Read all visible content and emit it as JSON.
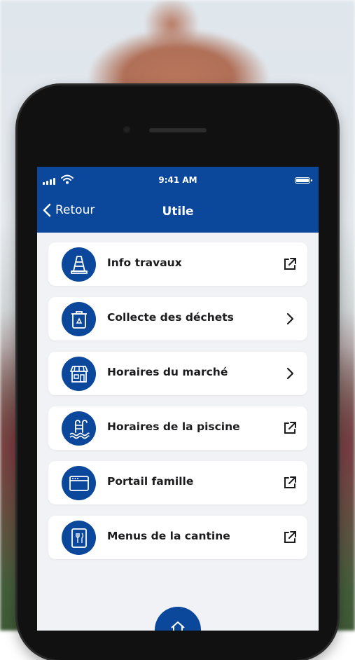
{
  "status_bar": {
    "time": "9:41 AM"
  },
  "header": {
    "back_label": "Retour",
    "title": "Utile"
  },
  "items": [
    {
      "label": "Info travaux",
      "icon": "traffic-cone-icon",
      "action": "external-link-icon"
    },
    {
      "label": "Collecte des déchets",
      "icon": "recycling-bin-icon",
      "action": "chevron-right-icon"
    },
    {
      "label": "Horaires du marché",
      "icon": "market-stall-icon",
      "action": "chevron-right-icon"
    },
    {
      "label": "Horaires de la piscine",
      "icon": "swimming-pool-icon",
      "action": "external-link-icon"
    },
    {
      "label": "Portail famille",
      "icon": "browser-window-icon",
      "action": "external-link-icon"
    },
    {
      "label": "Menus de la cantine",
      "icon": "menu-card-icon",
      "action": "external-link-icon"
    }
  ],
  "fab": {
    "icon": "home-icon"
  },
  "colors": {
    "primary": "#0b479a",
    "screen_bg": "#f1f2f5",
    "card_bg": "#ffffff"
  }
}
